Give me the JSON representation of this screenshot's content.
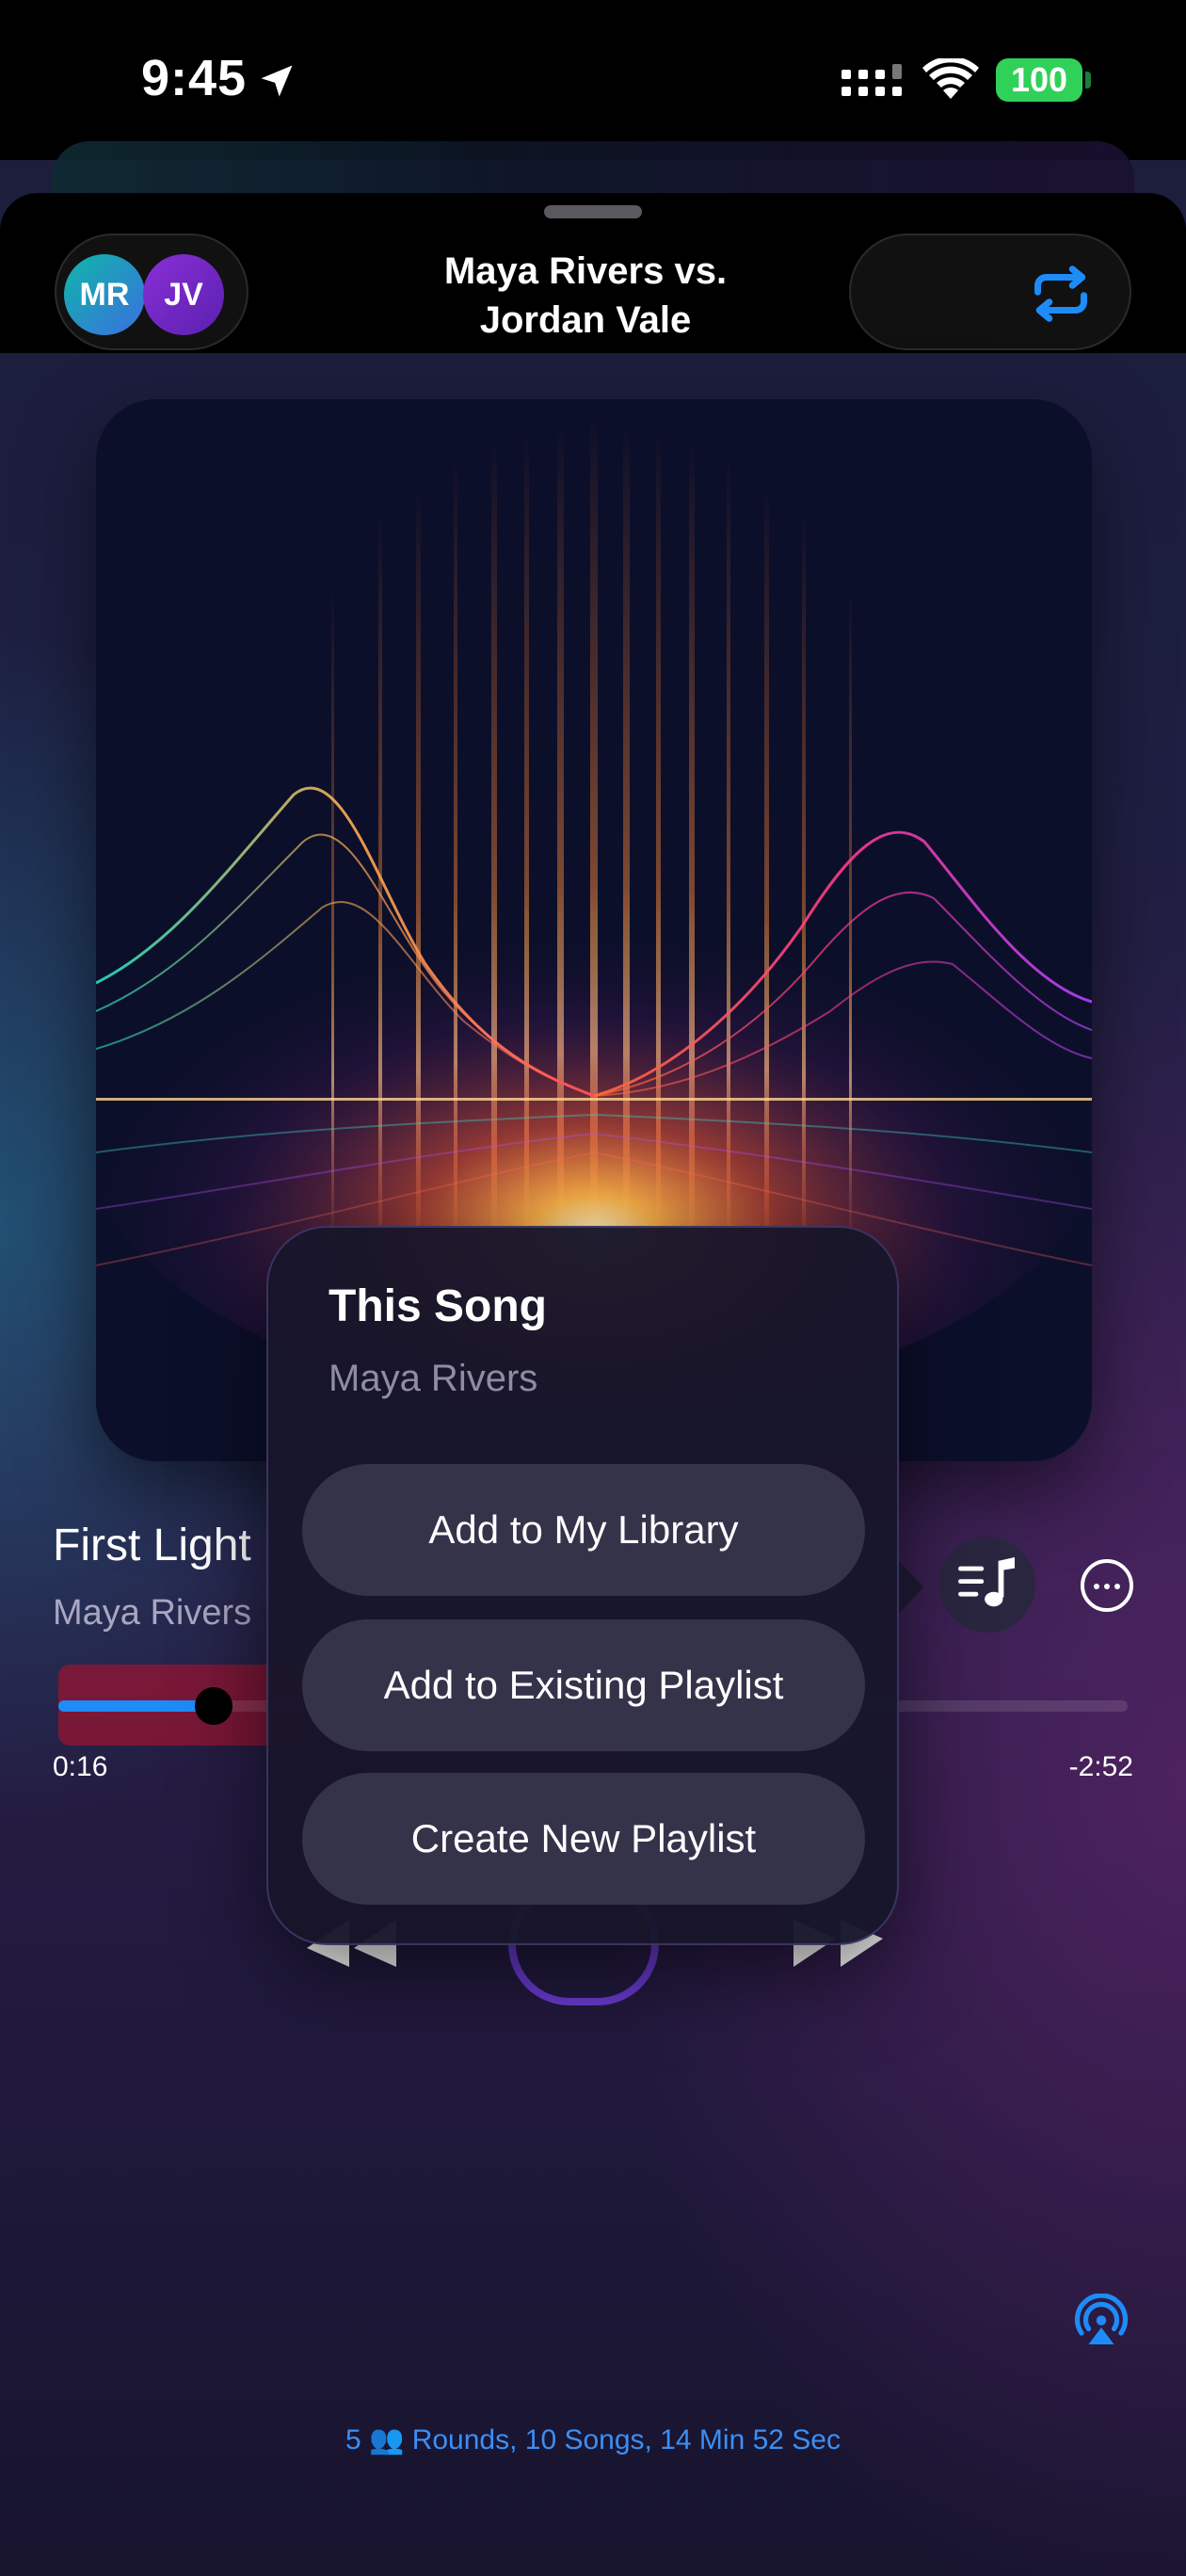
{
  "status_bar": {
    "time": "9:45",
    "battery": "100",
    "battery_color": "#30d158"
  },
  "header": {
    "avatars": [
      {
        "initials": "MR"
      },
      {
        "initials": "JV"
      }
    ],
    "title": "Maya Rivers vs. Jordan Vale",
    "repeat_icon": "repeat-icon"
  },
  "now_playing": {
    "title": "First Light",
    "artist": "Maya Rivers",
    "elapsed": "0:16",
    "remaining": "-2:52",
    "progress": 0.092
  },
  "popover": {
    "title": "This Song",
    "subtitle": "Maya Rivers",
    "actions": [
      {
        "label": "Add to My Library"
      },
      {
        "label": "Add to Existing Playlist"
      },
      {
        "label": "Create New Playlist"
      }
    ]
  },
  "footer": {
    "summary": "5 👥 Rounds, 10 Songs, 14 Min 52 Sec"
  },
  "colors": {
    "accent": "#1d8cf8",
    "background": "#1e1f42"
  }
}
